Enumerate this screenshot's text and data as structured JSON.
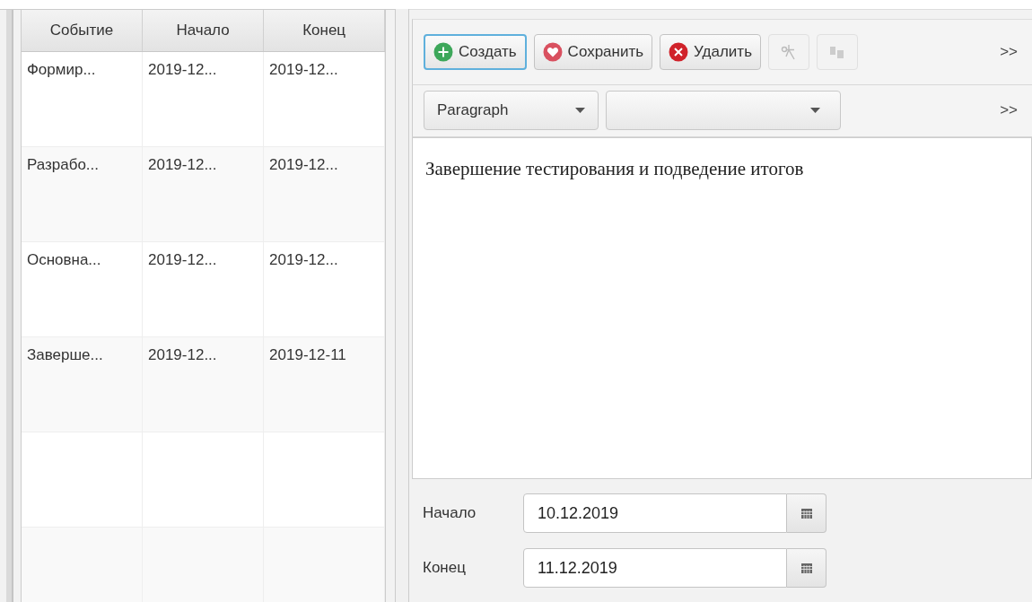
{
  "table": {
    "columns": [
      "Событие",
      "Начало",
      "Конец"
    ],
    "rows": [
      [
        "Формир...",
        "2019-12...",
        "2019-12..."
      ],
      [
        "Разрабо...",
        "2019-12...",
        "2019-12..."
      ],
      [
        "Основна...",
        "2019-12...",
        "2019-12..."
      ],
      [
        "Заверше...",
        "2019-12...",
        "2019-12-11"
      ],
      [
        "",
        "",
        ""
      ],
      [
        "",
        "",
        ""
      ]
    ]
  },
  "toolbar": {
    "buttons": [
      {
        "kind": "create",
        "label": "Создать",
        "focused": true,
        "disabled": false
      },
      {
        "kind": "save",
        "label": "Сохранить",
        "focused": false,
        "disabled": false
      },
      {
        "kind": "delete",
        "label": "Удалить",
        "focused": false,
        "disabled": false
      },
      {
        "kind": "cut",
        "focused": false,
        "disabled": true
      },
      {
        "kind": "copy",
        "focused": false,
        "disabled": true
      }
    ],
    "overflow": ">>"
  },
  "format_bar": {
    "paragraph_select": "Paragraph",
    "overflow": ">>"
  },
  "editor": {
    "text": "Завершение тестирования и подведение итогов"
  },
  "form": {
    "fields": [
      {
        "label": "Начало",
        "value": "10.12.2019"
      },
      {
        "label": "Конец",
        "value": "11.12.2019"
      }
    ]
  }
}
